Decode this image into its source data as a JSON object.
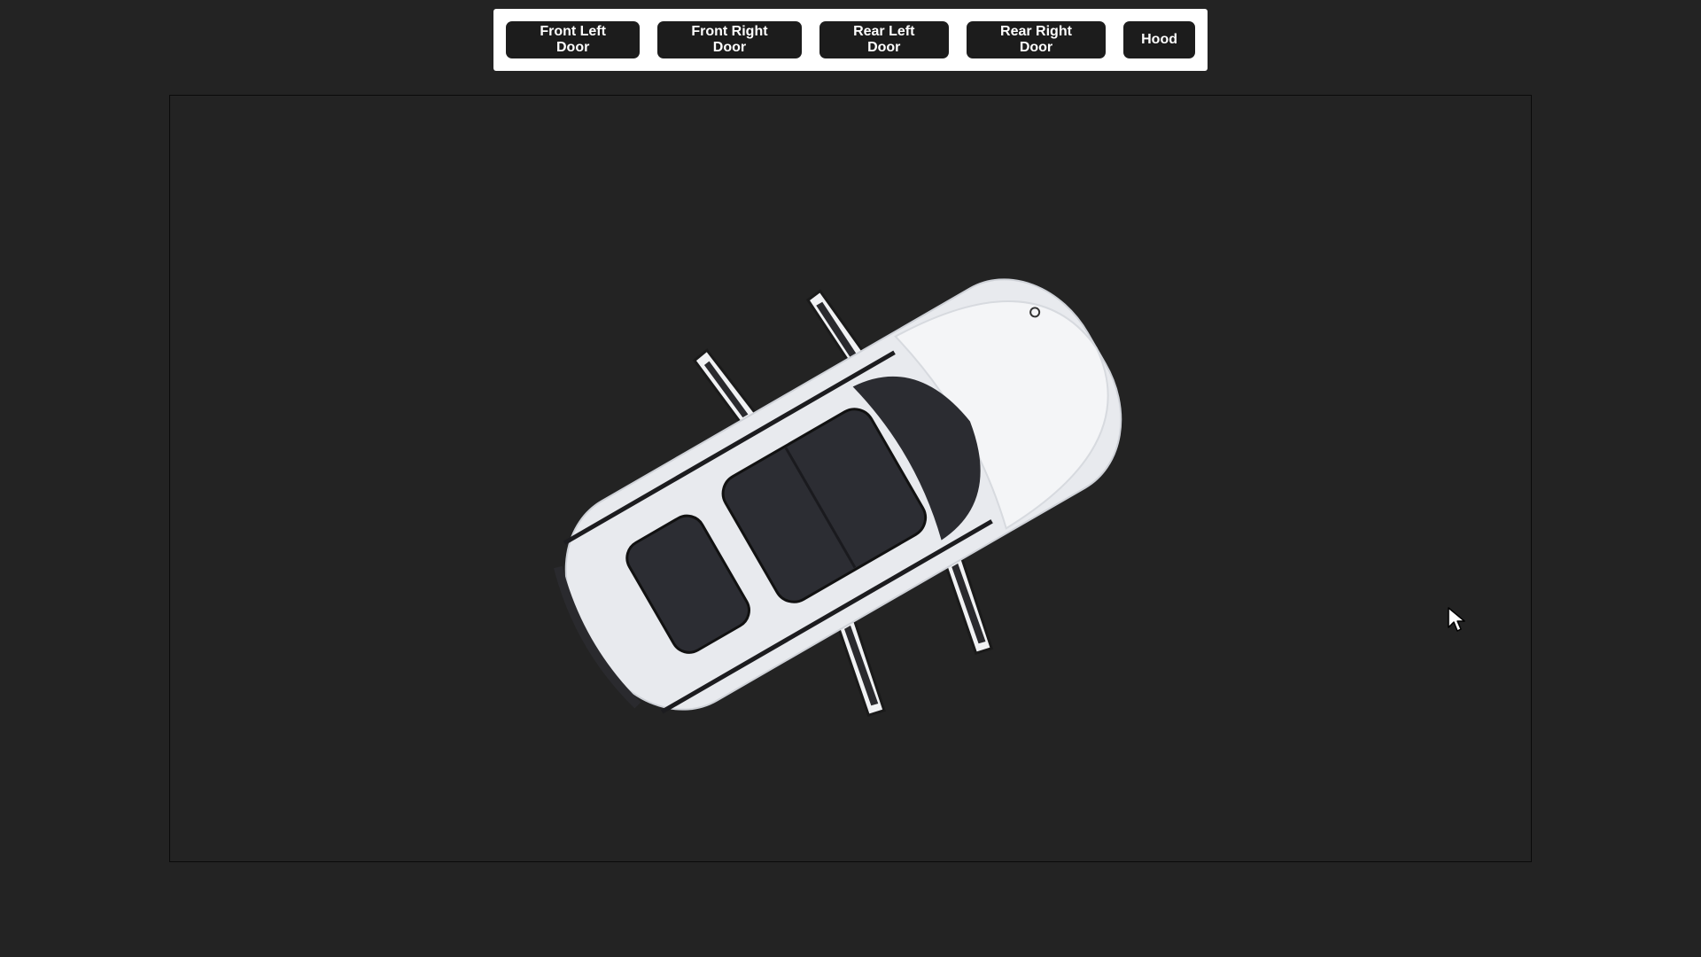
{
  "toolbar": {
    "buttons": [
      {
        "label": "Front Left Door"
      },
      {
        "label": "Front Right Door"
      },
      {
        "label": "Rear Left Door"
      },
      {
        "label": "Rear Right Door"
      },
      {
        "label": "Hood"
      }
    ]
  },
  "viewport": {
    "subject": "car-3d-model-top-view",
    "background_color": "#232323",
    "car_color": "#e8eaee"
  },
  "cursor": {
    "icon": "arrow-pointer-icon"
  }
}
